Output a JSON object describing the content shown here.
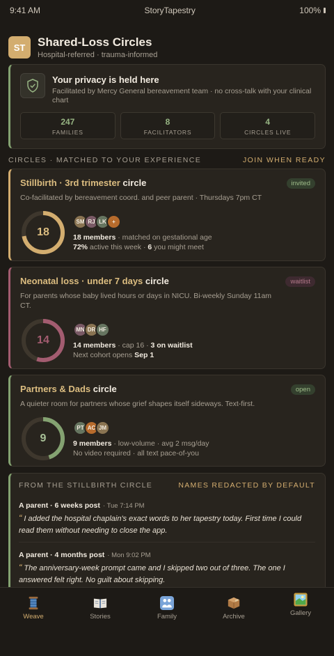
{
  "status_bar": {
    "time": "9:41 AM",
    "carrier": "StoryTapestry",
    "battery": "100%"
  },
  "header": {
    "logo_text": "ST",
    "title": "Shared-Loss Circles",
    "subtitle": "Hospital-referred · trauma-informed"
  },
  "privacy": {
    "title": "Your privacy is held here",
    "description": "Facilitated by Mercy General bereavement team · no cross-talk with your clinical chart",
    "stats": [
      {
        "value": "247",
        "label": "FAMILIES"
      },
      {
        "value": "8",
        "label": "FACILITATORS"
      },
      {
        "value": "4",
        "label": "CIRCLES LIVE"
      }
    ]
  },
  "section": {
    "title": "CIRCLES · MATCHED TO YOUR EXPERIENCE",
    "link": "JOIN WHEN READY"
  },
  "circles": [
    {
      "title_accent": "Stillbirth · 3rd trimester",
      "title_rest": " circle",
      "badge": "invited",
      "description": "Co-facilitated by bereavement coord. and peer parent · Thursdays 7pm CT",
      "ring_number": "18",
      "ring_fraction": 0.72,
      "avatars": [
        "SM",
        "RJ",
        "LK",
        "+"
      ],
      "meta1_bold": "18 members",
      "meta1_rest": " · matched on gestational age",
      "meta2_bold1": "72%",
      "meta2_mid": " active this week · ",
      "meta2_bold2": "6",
      "meta2_rest": " you might meet"
    },
    {
      "title_accent": "Neonatal loss · under 7 days",
      "title_rest": " circle",
      "badge": "waitlist",
      "description": "For parents whose baby lived hours or days in NICU. Bi-weekly Sunday 11am CT.",
      "ring_number": "14",
      "ring_fraction": 0.55,
      "avatars": [
        "MN",
        "DR",
        "HF"
      ],
      "meta1_bold": "14 members",
      "meta1_rest": " · cap 16 · ",
      "meta1_bold2": "3 on waitlist",
      "meta2_pre": "Next cohort opens ",
      "meta2_bold": "Sep 1"
    },
    {
      "title_accent": "Partners & Dads",
      "title_rest": " circle",
      "badge": "open",
      "description": "A quieter room for partners whose grief shapes itself sideways. Text-first.",
      "ring_number": "9",
      "ring_fraction": 0.45,
      "avatars": [
        "PT",
        "AC",
        "JM"
      ],
      "meta1_bold": "9 members",
      "meta1_rest": " · low-volume · avg 2 msg/day",
      "meta2_pre": "No video required · all text pace-of-you"
    }
  ],
  "feed": {
    "title": "FROM THE STILLBIRTH CIRCLE",
    "note": "NAMES REDACTED BY DEFAULT",
    "posts": [
      {
        "author": "A parent · 6 weeks post",
        "time": "· Tue 7:14 PM",
        "text": "I added the hospital chaplain's exact words to her tapestry today. First time I could read them without needing to close the app."
      },
      {
        "author": "A parent · 4 months post",
        "time": "· Mon 9:02 PM",
        "text": "The anniversary-week prompt came and I skipped two out of three. The one I answered felt right. No guilt about skipping."
      }
    ]
  },
  "tabs": [
    {
      "label": "Weave",
      "icon": "spool-icon"
    },
    {
      "label": "Stories",
      "icon": "book-icon"
    },
    {
      "label": "Family",
      "icon": "family-icon"
    },
    {
      "label": "Archive",
      "icon": "box-icon"
    },
    {
      "label": "Gallery",
      "icon": "picture-icon"
    }
  ],
  "colors": {
    "accent_gold": "#d3ad6f",
    "accent_green": "#84a271",
    "accent_rose": "#a35c70",
    "background": "#1d1a16"
  }
}
